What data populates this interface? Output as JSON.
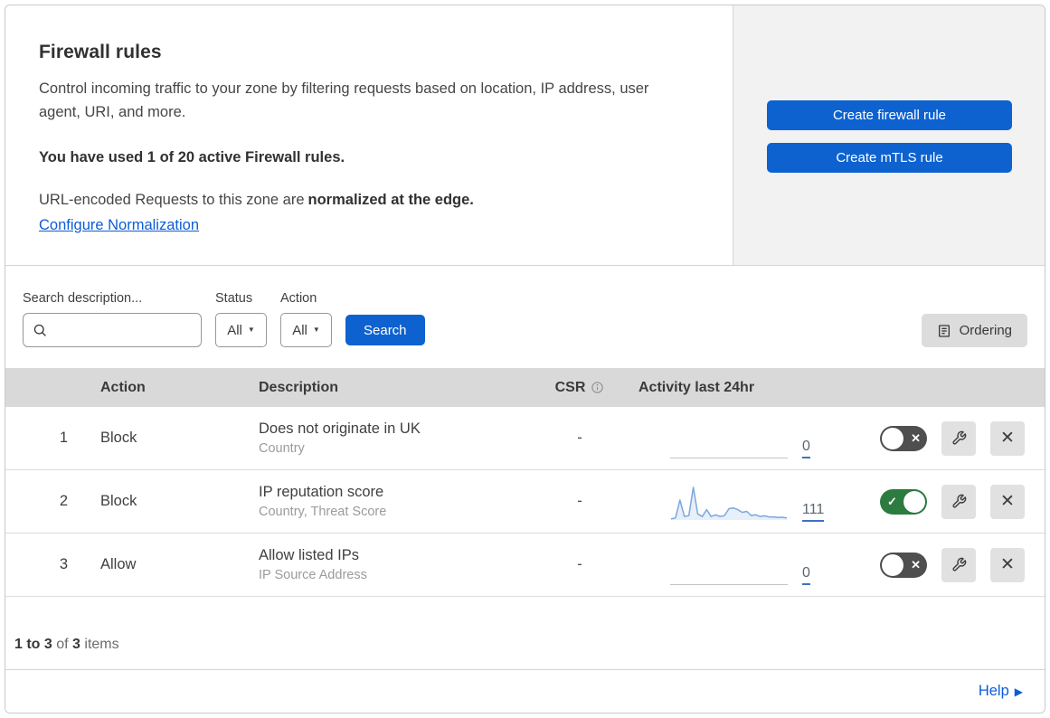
{
  "colors": {
    "primary_blue": "#0d62d0",
    "link_blue": "#0b5dd7",
    "toggle_on_green": "#2c7b40",
    "toggle_off_gray": "#4f4f4f",
    "sparkline_blue": "#7ba7dd",
    "table_header_bg": "#d9d9d9",
    "side_panel_bg": "#f2f2f2"
  },
  "icons": {
    "check": "✓",
    "cross": "✕",
    "close": "✕",
    "caret_down": "▼",
    "help_arrow": "▶"
  },
  "header": {
    "title": "Firewall rules",
    "description": "Control incoming traffic to your zone by filtering requests based on location, IP address, user agent, URI, and more.",
    "usage": "You have used 1 of 20 active Firewall rules.",
    "normalization_text": "URL-encoded Requests to this zone are",
    "normalization_bold": "normalized at the edge.",
    "normalization_link": "Configure Normalization",
    "create_firewall_button": "Create firewall rule",
    "create_mtls_button": "Create mTLS rule"
  },
  "filters": {
    "search_label": "Search description...",
    "status_label": "Status",
    "status_value": "All",
    "action_label": "Action",
    "action_value": "All",
    "search_button": "Search",
    "ordering_button": "Ordering"
  },
  "table": {
    "columns": {
      "action": "Action",
      "description": "Description",
      "csr": "CSR",
      "activity": "Activity last 24hr"
    },
    "rows": [
      {
        "number": "1",
        "action": "Block",
        "description": "Does not originate in UK",
        "criteria": "Country",
        "csr": "-",
        "activity_count": "0",
        "enabled": false,
        "sparkline": []
      },
      {
        "number": "2",
        "action": "Block",
        "description": "IP reputation score",
        "criteria": "Country, Threat Score",
        "csr": "-",
        "activity_count": "111",
        "enabled": true,
        "sparkline": [
          0.03,
          0.06,
          0.58,
          0.1,
          0.13,
          0.95,
          0.18,
          0.1,
          0.3,
          0.1,
          0.15,
          0.1,
          0.13,
          0.33,
          0.35,
          0.3,
          0.22,
          0.25,
          0.13,
          0.15,
          0.1,
          0.12,
          0.09,
          0.09,
          0.07,
          0.08,
          0.06
        ]
      },
      {
        "number": "3",
        "action": "Allow",
        "description": "Allow listed IPs",
        "criteria": "IP Source Address",
        "csr": "-",
        "activity_count": "0",
        "enabled": false,
        "sparkline": []
      }
    ]
  },
  "footer": {
    "range_bold": "1 to 3",
    "of_text": " of ",
    "total_bold": "3",
    "items_text": " items",
    "help_label": "Help"
  }
}
